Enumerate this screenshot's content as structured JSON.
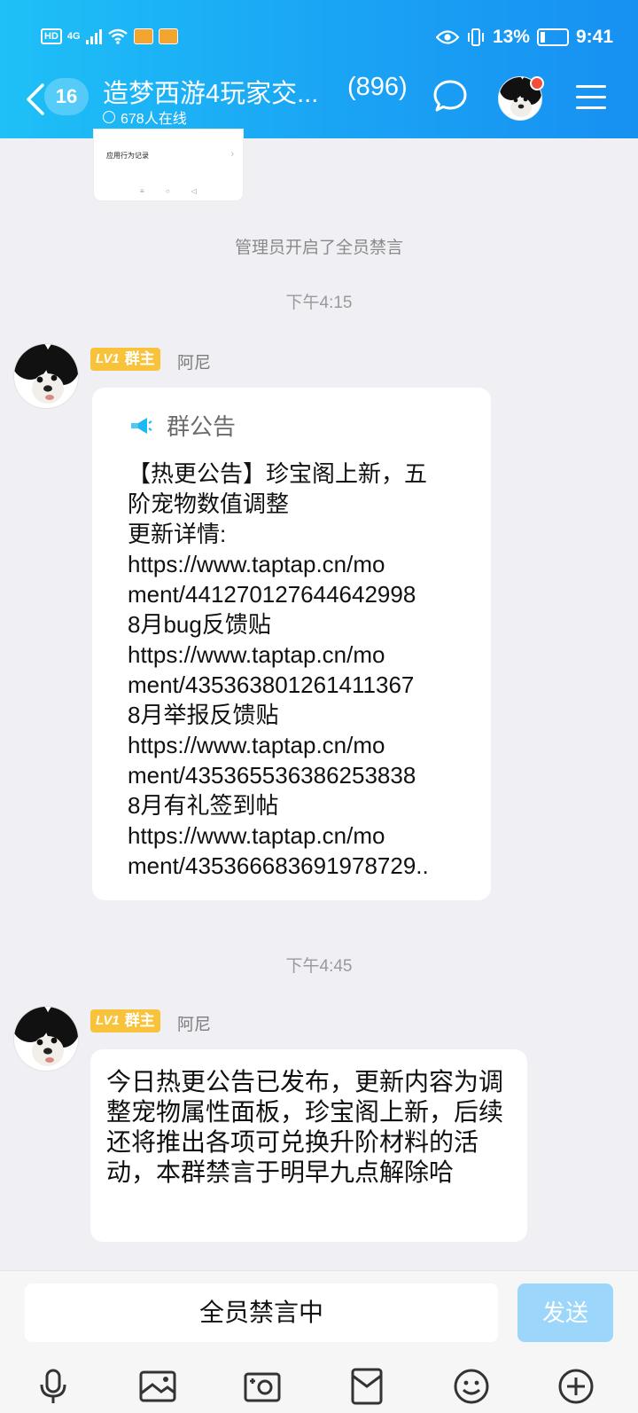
{
  "status_bar": {
    "hd": "HD",
    "network": "4G",
    "battery": "13%",
    "time": "9:41"
  },
  "header": {
    "unread_count": "16",
    "group_name": "造梦西游4玩家交...",
    "member_count": "(896)",
    "online": "678人在线"
  },
  "thumbnail": {
    "row_label": "应用行为记录"
  },
  "chat": {
    "system_notice": "管理员开启了全员禁言",
    "time1": "下午4:15",
    "time2": "下午4:45",
    "sender_level": "LV1",
    "sender_role": "群主",
    "sender_name": "阿尼",
    "announcement": {
      "heading": "群公告",
      "lines": [
        "【热更公告】珍宝阁上新，五",
        "阶宠物数值调整",
        "更新详情:",
        " https://www.taptap.cn/mo",
        "ment/441270127644642998",
        "8月bug反馈贴",
        " https://www.taptap.cn/mo",
        "ment/435363801261411367",
        "8月举报反馈贴",
        " https://www.taptap.cn/mo",
        "ment/435365536386253838",
        "8月有礼签到帖",
        " https://www.taptap.cn/mo",
        "ment/435366683691978729.."
      ]
    },
    "message2": "今日热更公告已发布，更新内容为调整宠物属性面板，珍宝阁上新，后续还将推出各项可兑换升阶材料的活动，本群禁言于明早九点解除哈"
  },
  "input": {
    "muted_text": "全员禁言中",
    "send_label": "发送"
  },
  "toolbar": [
    "microphone-icon",
    "image-icon",
    "camera-icon",
    "red-packet-icon",
    "emoji-icon",
    "plus-icon"
  ],
  "colors": {
    "header_start": "#1ec0f7",
    "header_end": "#1790f2",
    "owner_tag": "#f8c33b",
    "send_disabled": "#9dd6fb",
    "background": "#efeff4"
  }
}
